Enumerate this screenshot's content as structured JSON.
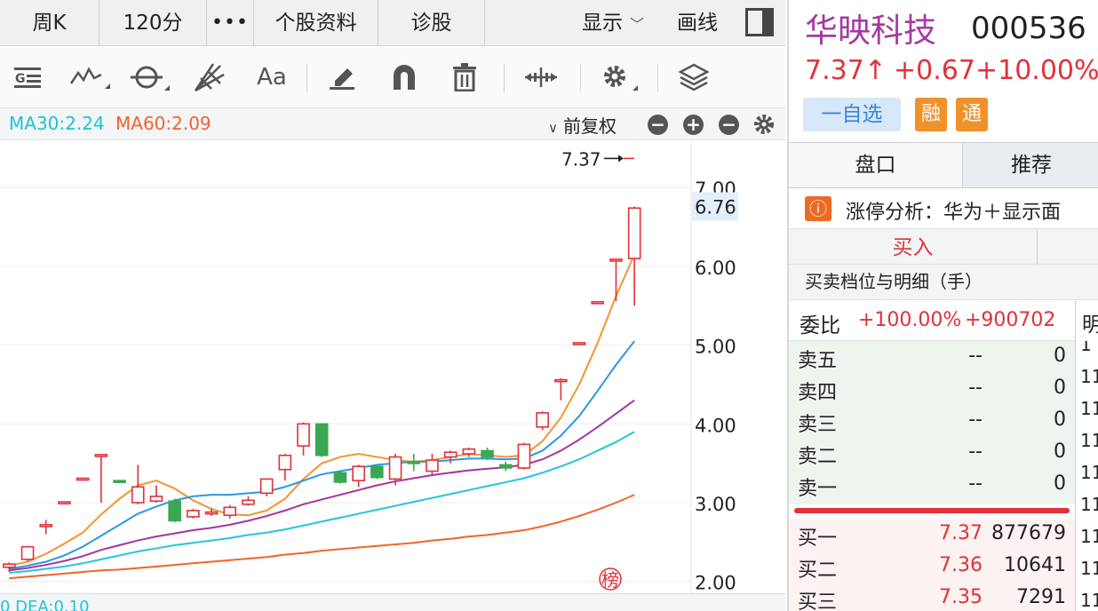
{
  "tabs": {
    "period": "周K",
    "minutes": "120分",
    "more": "•••",
    "profile": "个股资料",
    "diagnose": "诊股",
    "display": "显示",
    "draw": "画线"
  },
  "toolbar": {
    "tools": [
      "indicator-icon",
      "line-style-icon",
      "cycle-icon",
      "fan-icon",
      "text-icon",
      "eraser-icon",
      "magnet-icon",
      "trash-icon",
      "expand-icon",
      "settings-icon",
      "layers-icon"
    ],
    "text_tool_label": "Aa"
  },
  "ma_bar": {
    "ma30": "MA30:2.24",
    "ma60": "MA60:2.09",
    "adjust": "前复权"
  },
  "chart_data": {
    "type": "candlestick",
    "yticks": [
      "7.00",
      "6.00",
      "5.00",
      "4.00",
      "3.00",
      "2.00"
    ],
    "ylim": [
      1.85,
      7.6
    ],
    "last_price_label": "7.37",
    "current_price_tag": "6.76",
    "rank_badge": "榜",
    "candles": [
      {
        "o": 2.18,
        "h": 2.24,
        "l": 2.12,
        "c": 2.22
      },
      {
        "o": 2.28,
        "h": 2.45,
        "l": 2.26,
        "c": 2.44
      },
      {
        "o": 2.7,
        "h": 2.78,
        "l": 2.6,
        "c": 2.72
      },
      {
        "o": 3.0,
        "h": 3.0,
        "l": 2.98,
        "c": 3.01
      },
      {
        "o": 3.3,
        "h": 3.3,
        "l": 3.28,
        "c": 3.31
      },
      {
        "o": 3.6,
        "h": 3.62,
        "l": 3.0,
        "c": 3.61
      },
      {
        "o": 3.28,
        "h": 3.28,
        "l": 3.26,
        "c": 3.27
      },
      {
        "o": 3.0,
        "h": 3.48,
        "l": 2.98,
        "c": 3.2
      },
      {
        "o": 3.02,
        "h": 3.22,
        "l": 3.0,
        "c": 3.08
      },
      {
        "o": 3.02,
        "h": 3.05,
        "l": 2.75,
        "c": 2.77
      },
      {
        "o": 2.82,
        "h": 2.92,
        "l": 2.8,
        "c": 2.9
      },
      {
        "o": 2.86,
        "h": 2.93,
        "l": 2.83,
        "c": 2.88
      },
      {
        "o": 2.84,
        "h": 2.97,
        "l": 2.8,
        "c": 2.94
      },
      {
        "o": 2.98,
        "h": 3.08,
        "l": 2.96,
        "c": 3.03
      },
      {
        "o": 3.12,
        "h": 3.31,
        "l": 3.08,
        "c": 3.3
      },
      {
        "o": 3.42,
        "h": 3.62,
        "l": 3.28,
        "c": 3.6
      },
      {
        "o": 3.72,
        "h": 4.02,
        "l": 3.6,
        "c": 4.0
      },
      {
        "o": 4.0,
        "h": 4.0,
        "l": 3.58,
        "c": 3.6
      },
      {
        "o": 3.38,
        "h": 3.4,
        "l": 3.24,
        "c": 3.26
      },
      {
        "o": 3.28,
        "h": 3.48,
        "l": 3.2,
        "c": 3.46
      },
      {
        "o": 3.46,
        "h": 3.48,
        "l": 3.3,
        "c": 3.32
      },
      {
        "o": 3.3,
        "h": 3.62,
        "l": 3.22,
        "c": 3.58
      },
      {
        "o": 3.52,
        "h": 3.62,
        "l": 3.4,
        "c": 3.5
      },
      {
        "o": 3.4,
        "h": 3.62,
        "l": 3.36,
        "c": 3.54
      },
      {
        "o": 3.58,
        "h": 3.66,
        "l": 3.5,
        "c": 3.64
      },
      {
        "o": 3.62,
        "h": 3.7,
        "l": 3.58,
        "c": 3.68
      },
      {
        "o": 3.66,
        "h": 3.7,
        "l": 3.54,
        "c": 3.58
      },
      {
        "o": 3.48,
        "h": 3.52,
        "l": 3.4,
        "c": 3.44
      },
      {
        "o": 3.44,
        "h": 3.76,
        "l": 3.42,
        "c": 3.74
      },
      {
        "o": 3.96,
        "h": 4.16,
        "l": 3.92,
        "c": 4.14
      },
      {
        "o": 4.55,
        "h": 4.58,
        "l": 4.3,
        "c": 4.56
      },
      {
        "o": 5.02,
        "h": 5.04,
        "l": 5.0,
        "c": 5.03
      },
      {
        "o": 5.54,
        "h": 5.56,
        "l": 5.52,
        "c": 5.55
      },
      {
        "o": 6.08,
        "h": 6.1,
        "l": 5.56,
        "c": 6.09
      },
      {
        "o": 6.1,
        "h": 6.76,
        "l": 5.5,
        "c": 6.74
      }
    ],
    "series": [
      {
        "color": "#f3952f",
        "values": [
          2.2,
          2.25,
          2.35,
          2.48,
          2.62,
          2.85,
          3.05,
          3.22,
          3.28,
          3.18,
          3.03,
          2.92,
          2.85,
          2.84,
          2.9,
          3.05,
          3.3,
          3.5,
          3.58,
          3.62,
          3.58,
          3.54,
          3.52,
          3.54,
          3.58,
          3.62,
          3.6,
          3.58,
          3.6,
          3.78,
          4.08,
          4.5,
          5.03,
          5.62,
          6.15
        ]
      },
      {
        "color": "#2b98e4",
        "values": [
          2.16,
          2.2,
          2.25,
          2.33,
          2.44,
          2.58,
          2.72,
          2.86,
          2.95,
          3.03,
          3.08,
          3.1,
          3.1,
          3.12,
          3.14,
          3.2,
          3.28,
          3.36,
          3.4,
          3.44,
          3.48,
          3.5,
          3.52,
          3.52,
          3.54,
          3.56,
          3.56,
          3.55,
          3.56,
          3.66,
          3.85,
          4.1,
          4.42,
          4.75,
          5.05
        ]
      },
      {
        "color": "#a6349e",
        "values": [
          2.14,
          2.17,
          2.21,
          2.26,
          2.32,
          2.4,
          2.46,
          2.52,
          2.57,
          2.61,
          2.65,
          2.68,
          2.72,
          2.77,
          2.83,
          2.9,
          2.98,
          3.04,
          3.1,
          3.16,
          3.22,
          3.27,
          3.31,
          3.35,
          3.38,
          3.41,
          3.43,
          3.45,
          3.48,
          3.55,
          3.66,
          3.8,
          3.96,
          4.13,
          4.3
        ]
      },
      {
        "color": "#24c6dc",
        "values": [
          2.11,
          2.13,
          2.16,
          2.19,
          2.23,
          2.28,
          2.33,
          2.38,
          2.42,
          2.46,
          2.49,
          2.52,
          2.55,
          2.59,
          2.62,
          2.66,
          2.71,
          2.76,
          2.81,
          2.86,
          2.91,
          2.96,
          3.01,
          3.06,
          3.11,
          3.16,
          3.21,
          3.26,
          3.31,
          3.38,
          3.46,
          3.55,
          3.66,
          3.77,
          3.9
        ]
      },
      {
        "color": "#f2632c",
        "values": [
          2.04,
          2.06,
          2.08,
          2.1,
          2.12,
          2.14,
          2.15,
          2.17,
          2.19,
          2.21,
          2.23,
          2.25,
          2.27,
          2.29,
          2.31,
          2.34,
          2.36,
          2.39,
          2.41,
          2.43,
          2.45,
          2.47,
          2.49,
          2.52,
          2.54,
          2.57,
          2.59,
          2.62,
          2.65,
          2.7,
          2.76,
          2.83,
          2.91,
          3.0,
          3.1
        ]
      }
    ]
  },
  "sub_indicator": {
    "text": "0 DEA:0.10"
  },
  "stock": {
    "name": "华映科技",
    "code": "000536",
    "price": "7.37↑",
    "change": "+0.67",
    "pct": "+10.00%",
    "watch_label": "一自选",
    "badge_rong": "融",
    "badge_tong": "通"
  },
  "right_tabs": {
    "pankou": "盘口",
    "tuijian": "推荐"
  },
  "limit_analysis": {
    "icon": "ⓘ",
    "text": "涨停分析：华为＋显示面"
  },
  "trade": {
    "buy_tab": "买入",
    "detail_title": "买卖档位与明细（手）"
  },
  "orderbook": {
    "ratio_label": "委比",
    "ratio_pct": "+100.00%",
    "ratio_val": "+900702",
    "ming_head": "明",
    "sell": [
      {
        "label": "卖五",
        "price": "--",
        "vol": "0"
      },
      {
        "label": "卖四",
        "price": "--",
        "vol": "0"
      },
      {
        "label": "卖三",
        "price": "--",
        "vol": "0"
      },
      {
        "label": "卖二",
        "price": "--",
        "vol": "0"
      },
      {
        "label": "卖一",
        "price": "--",
        "vol": "0"
      }
    ],
    "buy": [
      {
        "label": "买一",
        "price": "7.37",
        "vol": "877679"
      },
      {
        "label": "买二",
        "price": "7.36",
        "vol": "10641"
      },
      {
        "label": "买三",
        "price": "7.35",
        "vol": "7291"
      }
    ],
    "ming_items": [
      "1",
      "11",
      "11",
      "11",
      "11",
      "11",
      "11",
      "11",
      "11"
    ]
  },
  "colors": {
    "up": "#e0323a",
    "down": "#3aa852",
    "accent_blue": "#3a86d6"
  }
}
